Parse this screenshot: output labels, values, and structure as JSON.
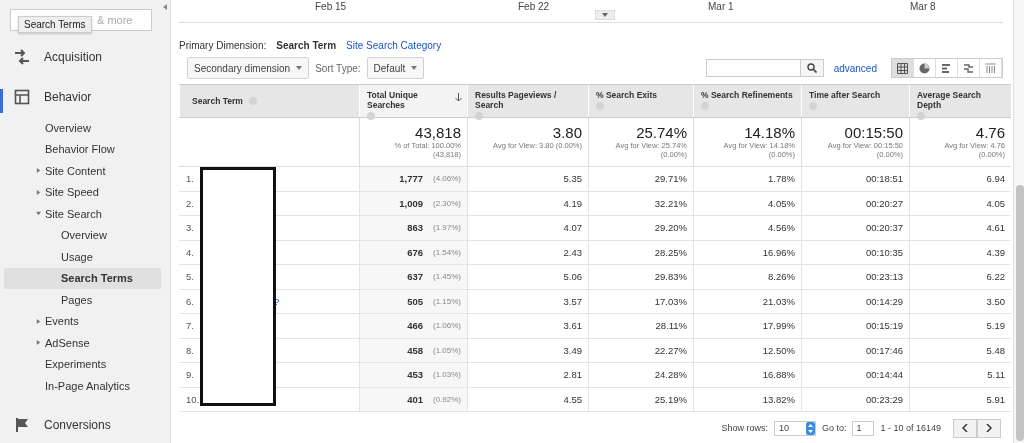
{
  "sidebar": {
    "search": {
      "placeholder": "& more"
    },
    "tooltip": "Search Terms",
    "items": [
      {
        "label": "Acquisition",
        "kind": "section",
        "selected": false
      },
      {
        "label": "Behavior",
        "kind": "section",
        "selected": true,
        "children": [
          {
            "label": "Overview",
            "kind": "link",
            "selected": false
          },
          {
            "label": "Behavior Flow",
            "kind": "link",
            "selected": false
          },
          {
            "label": "Site Content",
            "kind": "folder",
            "expanded": false,
            "selected": false
          },
          {
            "label": "Site Speed",
            "kind": "folder",
            "expanded": false,
            "selected": false
          },
          {
            "label": "Site Search",
            "kind": "folder",
            "expanded": true,
            "selected": false,
            "children": [
              {
                "label": "Overview",
                "kind": "link",
                "selected": false
              },
              {
                "label": "Usage",
                "kind": "link",
                "selected": false
              },
              {
                "label": "Search Terms",
                "kind": "link",
                "selected": true
              },
              {
                "label": "Pages",
                "kind": "link",
                "selected": false
              }
            ]
          },
          {
            "label": "Events",
            "kind": "folder",
            "expanded": false,
            "selected": false
          },
          {
            "label": "AdSense",
            "kind": "folder",
            "expanded": false,
            "selected": false
          },
          {
            "label": "Experiments",
            "kind": "link",
            "selected": false
          },
          {
            "label": "In-Page Analytics",
            "kind": "link",
            "selected": false
          }
        ]
      },
      {
        "label": "Conversions",
        "kind": "section",
        "selected": false
      }
    ]
  },
  "timeline": {
    "labels": [
      "Feb 15",
      "Feb 22",
      "Mar 1",
      "Mar 8"
    ]
  },
  "primary_dimension": {
    "label": "Primary Dimension:",
    "options": [
      {
        "label": "Search Term",
        "selected": true
      },
      {
        "label": "Site Search Category",
        "selected": false
      }
    ]
  },
  "toolbar": {
    "secondary_dimension": "Secondary dimension",
    "sort_label": "Sort Type:",
    "sort_value": "Default",
    "filter_link": "advanced",
    "views": [
      {
        "kind": "table",
        "selected": true
      },
      {
        "kind": "pie",
        "selected": false
      },
      {
        "kind": "bars",
        "selected": false
      },
      {
        "kind": "compare",
        "selected": false
      },
      {
        "kind": "pivot",
        "selected": false
      }
    ]
  },
  "table": {
    "columns": [
      {
        "label": "Search Term",
        "sorted": false
      },
      {
        "label": "Total Unique Searches",
        "sorted": true
      },
      {
        "label": "Results Pageviews / Search",
        "sorted": false
      },
      {
        "label": "% Search Exits",
        "sorted": false
      },
      {
        "label": "% Search Refinements",
        "sorted": false
      },
      {
        "label": "Time after Search",
        "sorted": false
      },
      {
        "label": "Average Search Depth",
        "sorted": false
      }
    ],
    "summary": [
      {
        "value": "43,818",
        "note": [
          "% of Total: 100.00%",
          "(43,818)"
        ]
      },
      {
        "value": "3.80",
        "note": [
          "Avg for View: 3.80 (0.00%)"
        ]
      },
      {
        "value": "25.74%",
        "note": [
          "Avg for View: 25.74%",
          "(0.00%)"
        ]
      },
      {
        "value": "14.18%",
        "note": [
          "Avg for View: 14.18%",
          "(0.00%)"
        ]
      },
      {
        "value": "00:15:50",
        "note": [
          "Avg for View: 00:15:50",
          "(0.00%)"
        ]
      },
      {
        "value": "4.76",
        "note": [
          "Avg for View: 4.76",
          "(0.00%)"
        ]
      }
    ],
    "rows": [
      {
        "index": "1.",
        "share": "(4.06%)",
        "cells": [
          "",
          "1,777",
          "5.35",
          "29.71%",
          "1.78%",
          "00:18:51",
          "6.94"
        ]
      },
      {
        "index": "2.",
        "share": "(2.30%)",
        "cells": [
          "",
          "1,009",
          "4.19",
          "32.21%",
          "4.05%",
          "00:20:27",
          "4.05"
        ]
      },
      {
        "index": "3.",
        "share": "(1.97%)",
        "cells": [
          "",
          "863",
          "4.07",
          "29.20%",
          "4.56%",
          "00:20:37",
          "4.61"
        ]
      },
      {
        "index": "4.",
        "share": "(1.54%)",
        "cells": [
          "",
          "676",
          "2.43",
          "28.25%",
          "16.96%",
          "00:10:35",
          "4.39"
        ]
      },
      {
        "index": "5.",
        "share": "(1.45%)",
        "cells": [
          "",
          "637",
          "5.06",
          "29.83%",
          "8.26%",
          "00:23:13",
          "6.22"
        ]
      },
      {
        "index": "6.",
        "share": "(1.15%)",
        "cells": [
          "?",
          "505",
          "3.57",
          "17.03%",
          "21.03%",
          "00:14:29",
          "3.50"
        ]
      },
      {
        "index": "7.",
        "share": "(1.06%)",
        "cells": [
          "",
          "466",
          "3.61",
          "28.11%",
          "17.99%",
          "00:15:19",
          "5.19"
        ]
      },
      {
        "index": "8.",
        "share": "(1.05%)",
        "cells": [
          "",
          "458",
          "3.49",
          "22.27%",
          "12.50%",
          "00:17:46",
          "5.48"
        ]
      },
      {
        "index": "9.",
        "share": "(1.03%)",
        "cells": [
          "",
          "453",
          "2.81",
          "24.28%",
          "16.88%",
          "00:14:44",
          "5.11"
        ]
      },
      {
        "index": "10.",
        "share": "(0.92%)",
        "cells": [
          "",
          "401",
          "4.55",
          "25.19%",
          "13.82%",
          "00:23:29",
          "5.91"
        ]
      }
    ]
  },
  "pager": {
    "show_rows_label": "Show rows:",
    "show_rows": "10",
    "goto_label": "Go to:",
    "goto": "1",
    "range": "1 - 10 of 16149"
  }
}
